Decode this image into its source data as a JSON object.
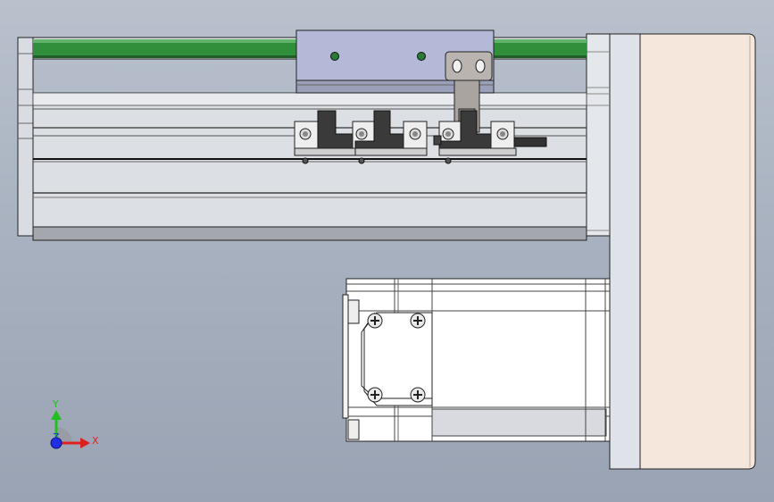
{
  "viewport": {
    "background_top": "#b9c1cd",
    "background_bottom": "#99a3b3"
  },
  "triad": {
    "x_label": "X",
    "y_label": "Y",
    "z_label": "Z",
    "x_color": "#e02020",
    "y_color": "#20c020",
    "z_color": "#2030e0"
  },
  "colors": {
    "rail_green": "#2f8f3a",
    "body_grey": "#d8dbe0",
    "carriage_blue": "#b3b9d6",
    "motor_beige": "#f6e7dc",
    "edge": "#222222",
    "sensor_dark": "#3a3a3a"
  },
  "parts": {
    "sensors": 3,
    "screws_on_motor_flange": 4,
    "carriage_pins": 2
  }
}
